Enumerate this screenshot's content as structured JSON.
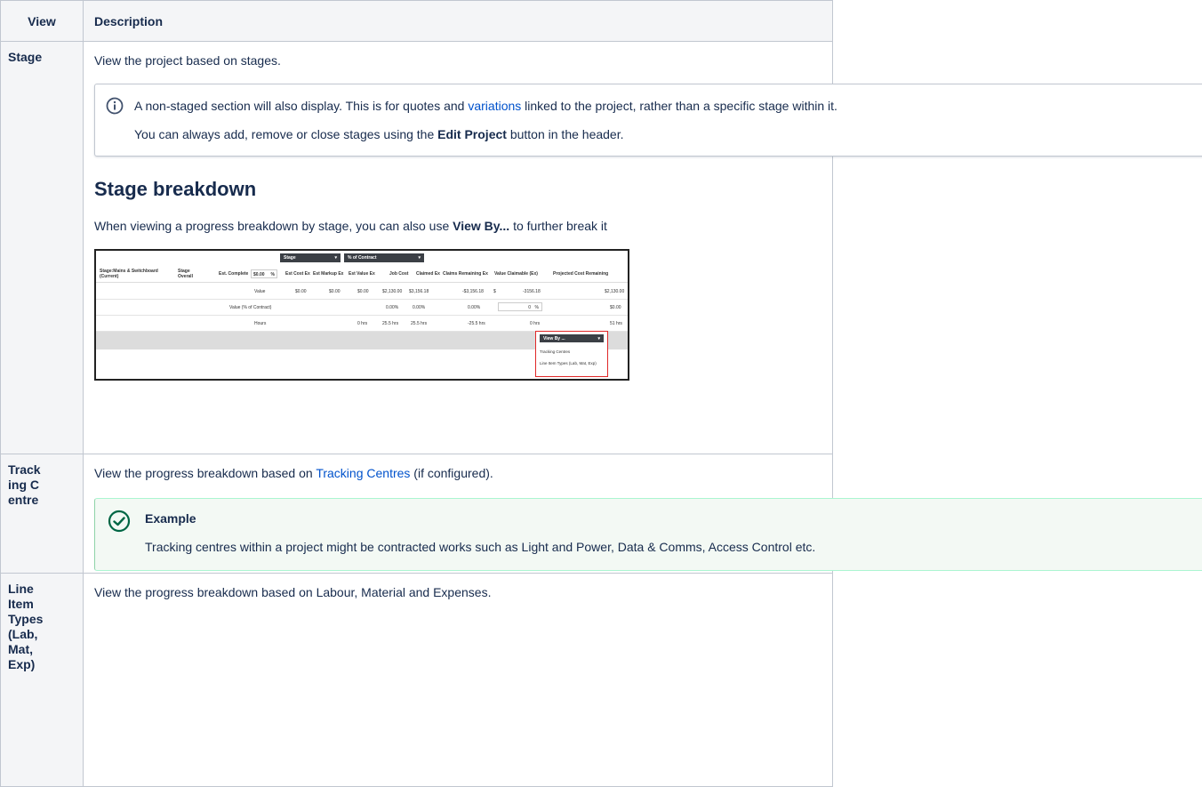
{
  "table": {
    "headers": {
      "view": "View",
      "description": "Description"
    },
    "stage": {
      "view": "Stage",
      "description": "View the project based on stages.",
      "info_p1_before": "A non-staged section will also display. This is for quotes and ",
      "info_p1_link": "variations",
      "info_p1_after": " linked to the project, rather than a specific stage within it.",
      "info_p2_before": "You can always add, remove or close stages using the ",
      "info_p2_bold": "Edit Project",
      "info_p2_after": " button in the header.",
      "heading": "Stage breakdown",
      "breakdown_before": "When viewing a progress breakdown by stage, you can also use ",
      "breakdown_bold": "View By...",
      "breakdown_after": " to further break it"
    },
    "tracking": {
      "view": "Tracking Centre",
      "description_before": "View the progress breakdown based on ",
      "description_link": "Tracking Centres",
      "description_after": " (if configured).",
      "example_title": "Example",
      "example_text": "Tracking centres within a project might be contracted works such as Light and Power, Data & Comms, Access Control etc."
    },
    "line_items": {
      "view": "Line Item Types (Lab, Mat, Exp)",
      "description": "View the progress breakdown based on Labour, Material and Expenses."
    }
  },
  "screenshot": {
    "dropdown_stage": "Stage",
    "dropdown_contract": "% of Contract",
    "col_stage_name": "Stage:Mains & Switchboard (Current)",
    "col_stage_overall": "Stage Overall",
    "col_est_complete": "Est. Complete",
    "est_complete_value": "$0.00",
    "est_complete_unit": "%",
    "col_est_cost": "Est Cost Ex",
    "col_est_markup": "Est Markup Ex",
    "col_est_value": "Est Value Ex",
    "col_job_cost": "Job Cost",
    "col_claimed": "Claimed Ex",
    "col_claims_remaining": "Claims Remaining Ex",
    "col_value_claimable": "Value Claimable (Ex)",
    "col_projected": "Projected Cost Remaining",
    "row_value": {
      "label": "Value",
      "est_cost": "$0.00",
      "est_markup": "$0.00",
      "est_value": "$0.00",
      "job_cost": "$2,130.00",
      "claimed": "$3,156.18",
      "claims_remaining": "-$3,156.18",
      "claimable_prefix": "$",
      "claimable": "-3156.18",
      "projected": "$2,130.00"
    },
    "row_value_pct": {
      "label": "Value (% of Contract)",
      "job_cost": "0.00%",
      "claimed": "0.00%",
      "claims_remaining": "0.00%",
      "claimable": "0",
      "claimable_unit": "%",
      "projected": "$0.00"
    },
    "row_hours": {
      "label": "Hours",
      "est_value": "0 hrs",
      "job_cost": "25.5 hrs",
      "claimed": "25.5 hrs",
      "claims_remaining": "-25.5 hrs",
      "claimable": "0 hrs",
      "projected": "51 hrs"
    },
    "view_by": "View By ...",
    "option_1": "Tracking Centres",
    "option_2": "Line Item Types (Lab, Mat, Exp)"
  }
}
